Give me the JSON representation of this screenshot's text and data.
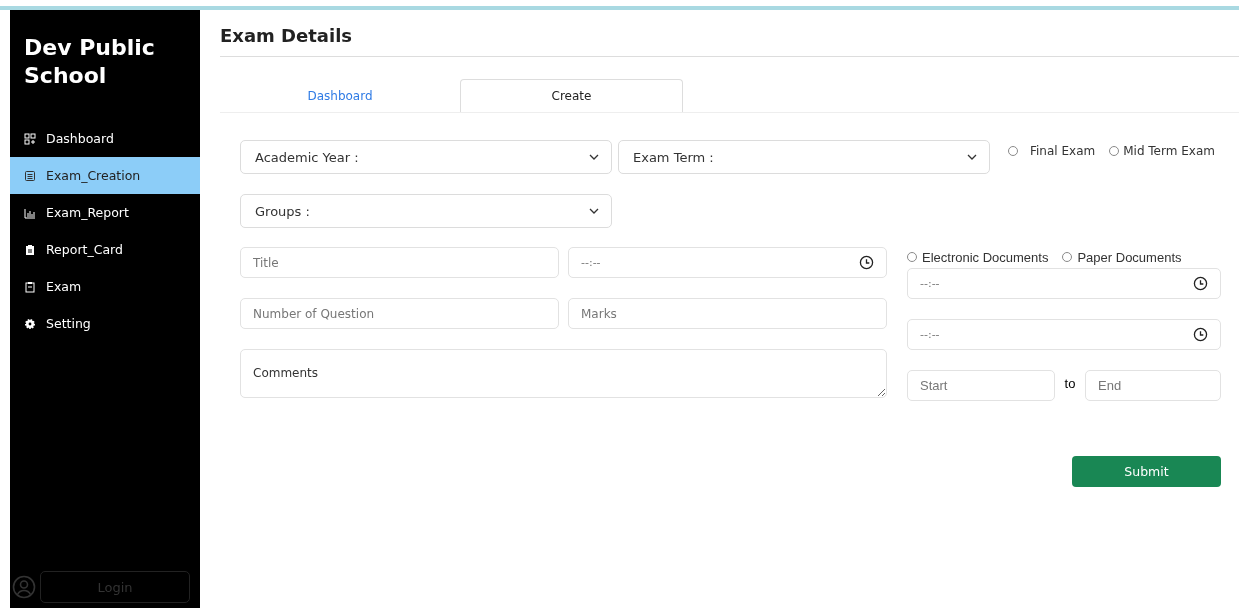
{
  "sidebar": {
    "school_name": "Dev Public School",
    "items": [
      {
        "label": "Dashboard",
        "selected": false
      },
      {
        "label": "Exam_Creation",
        "selected": true
      },
      {
        "label": "Exam_Report",
        "selected": false
      },
      {
        "label": "Report_Card",
        "selected": false
      },
      {
        "label": "Exam",
        "selected": false
      },
      {
        "label": "Setting",
        "selected": false
      }
    ],
    "login_button": "Login"
  },
  "page_title": "Exam Details",
  "tabs": [
    {
      "label": "Dashboard",
      "selected": false
    },
    {
      "label": "Create",
      "selected": true
    }
  ],
  "form": {
    "academic_year": {
      "placeholder": "Academic Year :"
    },
    "exam_term": {
      "placeholder": "Exam Term :"
    },
    "exam_type": [
      {
        "label": "Final Exam",
        "selected": false
      },
      {
        "label": "Mid Term Exam",
        "selected": false
      }
    ],
    "groups": {
      "placeholder": "Groups :"
    },
    "title": {
      "placeholder": "Title"
    },
    "time": {
      "placeholder": "--:--"
    },
    "number_of_questions": {
      "placeholder": "Number of Question"
    },
    "marks": {
      "placeholder": "Marks"
    },
    "comments": {
      "placeholder": "Comments"
    },
    "document_type": [
      {
        "label": "Electronic Documents",
        "selected": false
      },
      {
        "label": "Paper Documents",
        "selected": false
      }
    ],
    "start_time": {
      "placeholder": "--:--"
    },
    "end_time": {
      "placeholder": "--:--"
    },
    "range_start": {
      "placeholder": "Start"
    },
    "range_separator": "to",
    "range_end": {
      "placeholder": "End"
    },
    "submit": "Submit"
  }
}
